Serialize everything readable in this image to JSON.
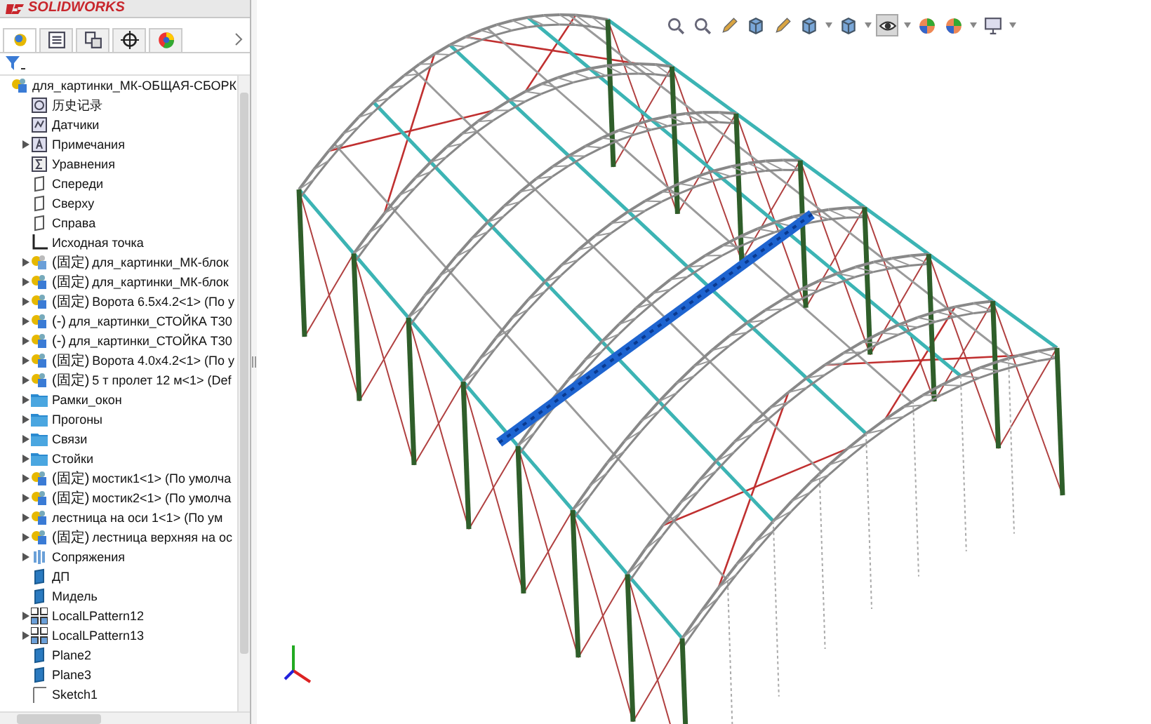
{
  "app": {
    "logo": "SOLIDWORKS"
  },
  "panel_tabs": [
    {
      "selected": true
    },
    {
      "selected": false
    },
    {
      "selected": false
    },
    {
      "selected": false
    },
    {
      "selected": false
    }
  ],
  "tree": {
    "label": "для_картинки_МК-ОБЩАЯ-СБОРК",
    "kind": "assembly",
    "children": [
      {
        "label": "历史记录",
        "kind": "history",
        "collapsible": false
      },
      {
        "label": "Датчики",
        "kind": "sensors",
        "collapsible": false
      },
      {
        "label": "Примечания",
        "kind": "annotations",
        "collapsible": true
      },
      {
        "label": "Уравнения",
        "kind": "equations",
        "collapsible": false
      },
      {
        "label": "Спереди",
        "kind": "ref-plane",
        "collapsible": false
      },
      {
        "label": "Сверху",
        "kind": "ref-plane",
        "collapsible": false
      },
      {
        "label": "Справа",
        "kind": "ref-plane",
        "collapsible": false
      },
      {
        "label": "Исходная точка",
        "kind": "origin",
        "collapsible": false
      },
      {
        "prefix": "(固定)",
        "label": "для_картинки_МК-блок",
        "kind": "assembly-fixed",
        "collapsible": true
      },
      {
        "prefix": "(固定)",
        "label": "для_картинки_МК-блок",
        "kind": "assembly",
        "collapsible": true
      },
      {
        "prefix": "(固定)",
        "label": "Ворота 6.5х4.2<1> (По у",
        "kind": "assembly",
        "collapsible": true
      },
      {
        "prefix": "(-)",
        "label": "для_картинки_СТОЙКА Т30",
        "kind": "assembly",
        "collapsible": true
      },
      {
        "prefix": "(-)",
        "label": "для_картинки_СТОЙКА Т30",
        "kind": "assembly",
        "collapsible": true
      },
      {
        "prefix": "(固定)",
        "label": "Ворота 4.0х4.2<1> (По у",
        "kind": "assembly",
        "collapsible": true
      },
      {
        "prefix": "(固定)",
        "label": "5 т пролет 12 м<1> (Def",
        "kind": "assembly",
        "collapsible": true
      },
      {
        "label": "Рамки_окон",
        "kind": "folder",
        "collapsible": true
      },
      {
        "label": "Прогоны",
        "kind": "folder",
        "collapsible": true
      },
      {
        "label": "Связи",
        "kind": "folder",
        "collapsible": true
      },
      {
        "label": "Стойки",
        "kind": "folder",
        "collapsible": true
      },
      {
        "prefix": "(固定)",
        "label": "мостик1<1> (По умолча",
        "kind": "assembly",
        "collapsible": true
      },
      {
        "prefix": "(固定)",
        "label": "мостик2<1> (По умолча",
        "kind": "assembly",
        "collapsible": true
      },
      {
        "label": "лестница на оси 1<1> (По ум",
        "kind": "assembly",
        "collapsible": true
      },
      {
        "prefix": "(固定)",
        "label": "лестница верхняя на ос",
        "kind": "assembly",
        "collapsible": true
      },
      {
        "label": "Сопряжения",
        "kind": "mates",
        "collapsible": true
      },
      {
        "label": "ДП",
        "kind": "plane",
        "collapsible": false
      },
      {
        "label": "Мидель",
        "kind": "plane",
        "collapsible": false
      },
      {
        "label": "LocalLPattern12",
        "kind": "pattern",
        "collapsible": true
      },
      {
        "label": "LocalLPattern13",
        "kind": "pattern",
        "collapsible": true
      },
      {
        "label": "Plane2",
        "kind": "plane",
        "collapsible": false
      },
      {
        "label": "Plane3",
        "kind": "plane",
        "collapsible": false
      },
      {
        "label": "Sketch1",
        "kind": "sketch",
        "collapsible": false
      }
    ]
  },
  "view_toolbar": [
    {
      "kind": "magnifier",
      "pressed": false
    },
    {
      "kind": "magnifier",
      "pressed": false
    },
    {
      "kind": "pencil",
      "pressed": false
    },
    {
      "kind": "cube",
      "pressed": false
    },
    {
      "kind": "pencil",
      "pressed": false
    },
    {
      "kind": "cube",
      "pressed": false
    },
    {
      "kind": "caret",
      "pressed": false
    },
    {
      "kind": "cube",
      "pressed": false
    },
    {
      "kind": "caret",
      "pressed": false
    },
    {
      "kind": "eye",
      "pressed": true
    },
    {
      "kind": "caret",
      "pressed": false
    },
    {
      "kind": "sphere",
      "pressed": false
    },
    {
      "kind": "sphere",
      "pressed": false
    },
    {
      "kind": "caret",
      "pressed": false
    },
    {
      "kind": "monitor",
      "pressed": false
    },
    {
      "kind": "caret",
      "pressed": false
    }
  ]
}
